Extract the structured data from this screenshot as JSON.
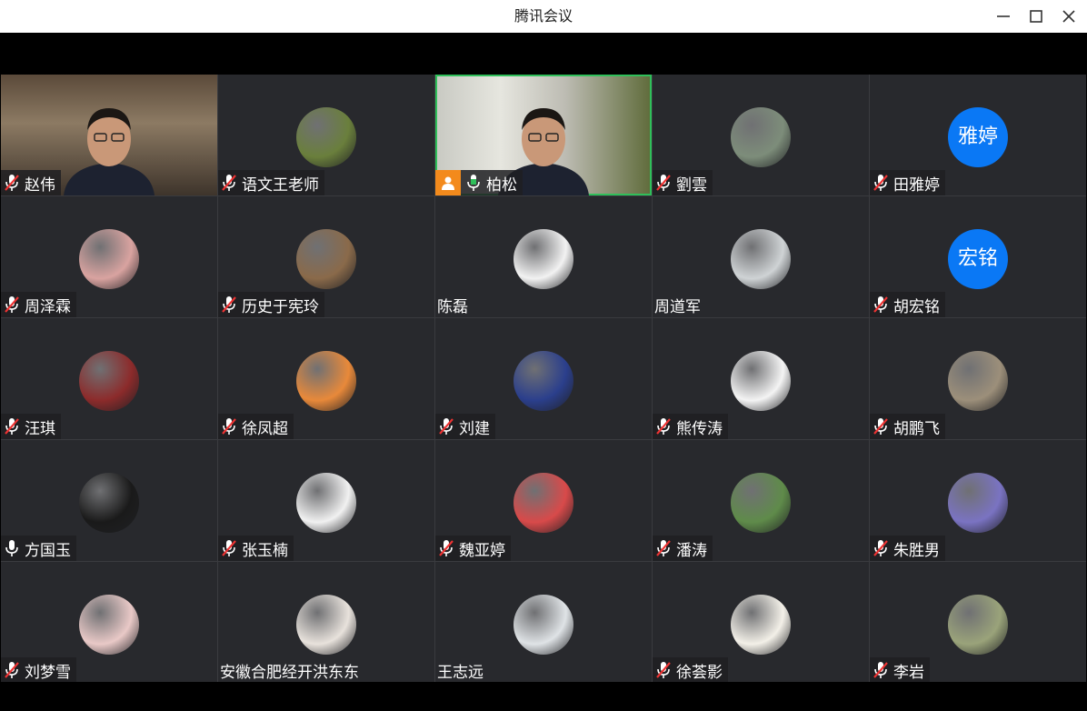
{
  "window": {
    "title": "腾讯会议"
  },
  "participants": [
    {
      "name": "赵伟",
      "mic": "muted",
      "view": "video-a"
    },
    {
      "name": "语文王老师",
      "mic": "muted",
      "view": "avatar",
      "avatar_color": "#6a7f3c"
    },
    {
      "name": "柏松",
      "mic": "active",
      "view": "video-b",
      "host": true
    },
    {
      "name": "劉雲",
      "mic": "muted",
      "view": "avatar",
      "avatar_color": "#7d8d7a"
    },
    {
      "name": "田雅婷",
      "mic": "muted",
      "view": "text",
      "avatar_text": "雅婷"
    },
    {
      "name": "周泽霖",
      "mic": "muted",
      "view": "avatar",
      "avatar_color": "#d9a3a0"
    },
    {
      "name": "历史于宪玲",
      "mic": "muted",
      "view": "avatar",
      "avatar_color": "#8a6a4a"
    },
    {
      "name": "陈磊",
      "mic": "none",
      "view": "avatar",
      "avatar_color": "#f2f2f2"
    },
    {
      "name": "周道军",
      "mic": "none",
      "view": "avatar",
      "avatar_color": "#cfd3d5"
    },
    {
      "name": "胡宏铭",
      "mic": "muted",
      "view": "text",
      "avatar_text": "宏铭"
    },
    {
      "name": "汪琪",
      "mic": "muted",
      "view": "avatar",
      "avatar_color": "#8c2b2b"
    },
    {
      "name": "徐凤超",
      "mic": "muted",
      "view": "avatar",
      "avatar_color": "#e8893a"
    },
    {
      "name": "刘建",
      "mic": "muted",
      "view": "avatar",
      "avatar_color": "#2b3f8c"
    },
    {
      "name": "熊传涛",
      "mic": "muted",
      "view": "avatar",
      "avatar_color": "#f4f4f4"
    },
    {
      "name": "胡鹏飞",
      "mic": "muted",
      "view": "avatar",
      "avatar_color": "#9c8f7a"
    },
    {
      "name": "方国玉",
      "mic": "on",
      "view": "avatar",
      "avatar_color": "#1a1a1a"
    },
    {
      "name": "张玉楠",
      "mic": "muted",
      "view": "avatar",
      "avatar_color": "#f1f1f1"
    },
    {
      "name": "魏亚婷",
      "mic": "muted",
      "view": "avatar",
      "avatar_color": "#d84a4a"
    },
    {
      "name": "潘涛",
      "mic": "muted",
      "view": "avatar",
      "avatar_color": "#5f8b4a"
    },
    {
      "name": "朱胜男",
      "mic": "muted",
      "view": "avatar",
      "avatar_color": "#7a73c2"
    },
    {
      "name": "刘梦雪",
      "mic": "muted",
      "view": "avatar",
      "avatar_color": "#e9c9c7"
    },
    {
      "name": "安徽合肥经开洪东东",
      "mic": "none",
      "view": "avatar",
      "avatar_color": "#e8e2dc"
    },
    {
      "name": "王志远",
      "mic": "none",
      "view": "avatar",
      "avatar_color": "#dfe3e6"
    },
    {
      "name": "徐荟影",
      "mic": "muted",
      "view": "avatar",
      "avatar_color": "#f3f0e8"
    },
    {
      "name": "李岩",
      "mic": "muted",
      "view": "avatar",
      "avatar_color": "#9aa37a"
    }
  ]
}
